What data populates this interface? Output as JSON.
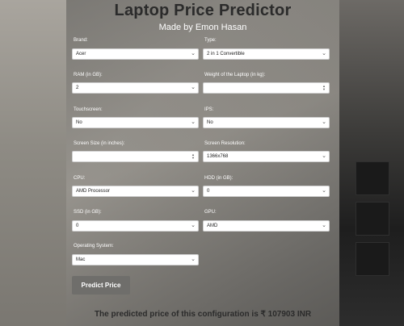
{
  "header": {
    "title": "Laptop Price Predictor",
    "subtitle": "Made by Emon Hasan"
  },
  "form": {
    "brand": {
      "label": "Brand:",
      "value": "Acer"
    },
    "type": {
      "label": "Type:",
      "value": "2 in 1 Convertible"
    },
    "ram": {
      "label": "RAM (in GB):",
      "value": "2"
    },
    "weight": {
      "label": "Weight of the Laptop (in kg):",
      "value": ""
    },
    "touchscreen": {
      "label": "Touchscreen:",
      "value": "No"
    },
    "ips": {
      "label": "IPS:",
      "value": "No"
    },
    "screen_size": {
      "label": "Screen Size (in inches):",
      "value": ""
    },
    "screen_resolution": {
      "label": "Screen Resolution:",
      "value": "1366x768"
    },
    "cpu": {
      "label": "CPU:",
      "value": "AMD Processor"
    },
    "hdd": {
      "label": "HDD (in GB):",
      "value": "0"
    },
    "ssd": {
      "label": "SSD (in GB):",
      "value": "0"
    },
    "gpu": {
      "label": "GPU:",
      "value": "AMD"
    },
    "os": {
      "label": "Operating System:",
      "value": "Mac"
    }
  },
  "actions": {
    "predict_label": "Predict Price"
  },
  "result": {
    "text": "The predicted price of this configuration is ₹ 107903 INR"
  },
  "icons": {
    "dropdown": "chevron-down-icon",
    "spinner": "number-spinner-icon"
  },
  "colors": {
    "title": "#2b2b2b",
    "button": "#6f6e6b"
  }
}
